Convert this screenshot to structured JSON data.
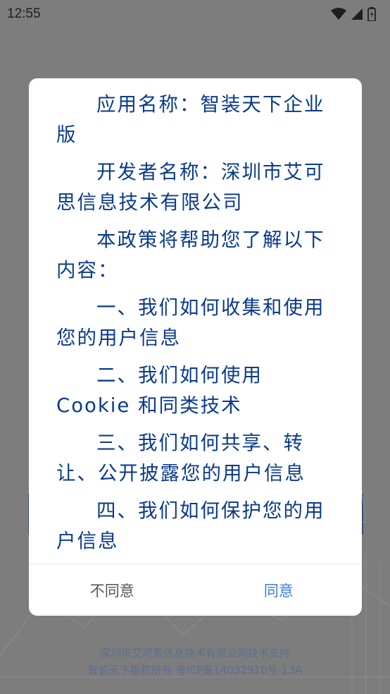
{
  "status_bar": {
    "time": "12:55"
  },
  "dialog": {
    "paragraphs": [
      "应用名称：智装天下企业版",
      "开发者名称：深圳市艾可思信息技术有限公司",
      "本政策将帮助您了解以下内容：",
      "一、我们如何收集和使用您的用户信息",
      "二、我们如何使用 Cookie 和同类技术",
      "三、我们如何共享、转让、公开披露您的用户信息",
      "四、我们如何保护您的用户信息"
    ],
    "disagree_label": "不同意",
    "agree_label": "同意"
  },
  "footer": {
    "line1": "深圳市艾可思信息技术有限公司技术支持",
    "line2": "智装天下版权所有 粤ICP备14032910号-13A"
  },
  "colors": {
    "text_blue": "#0a3a8c",
    "agree_blue": "#3a7ee4",
    "scrim": "#7d7d7d"
  }
}
